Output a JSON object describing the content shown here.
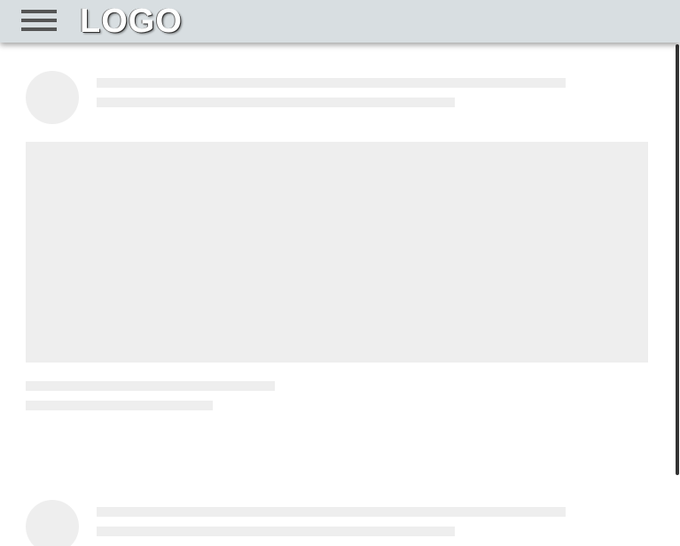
{
  "header": {
    "logo_text": "LOGO",
    "menu_icon": "hamburger-menu-icon",
    "background_color": "#d8dee1"
  },
  "skeleton_color": "#eeeeee",
  "feed": {
    "posts": [
      {
        "state": "loading"
      },
      {
        "state": "loading"
      }
    ]
  }
}
